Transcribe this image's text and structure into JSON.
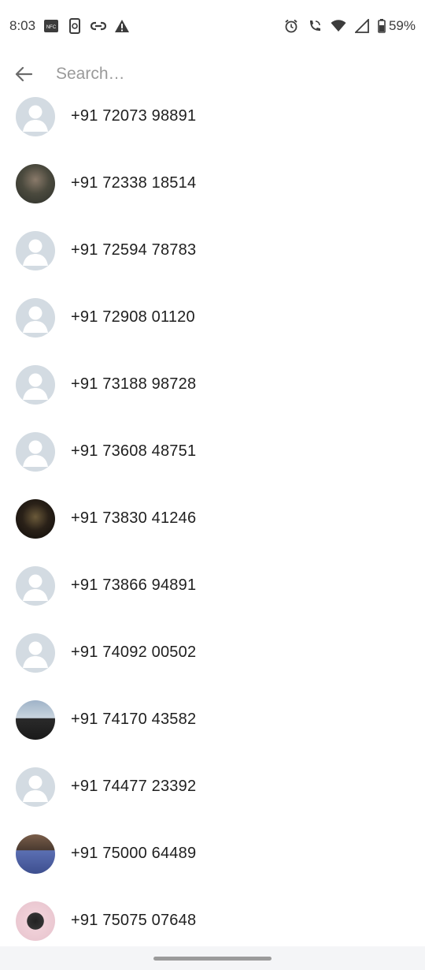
{
  "status_bar": {
    "time": "8:03",
    "battery": "59%",
    "left_icons": [
      "nfc-icon",
      "phone-lock-icon",
      "link-icon",
      "warning-icon"
    ],
    "right_icons": [
      "alarm-icon",
      "wifi-call-icon",
      "wifi-icon",
      "signal-icon",
      "battery-icon"
    ]
  },
  "search": {
    "placeholder": "Search…",
    "value": ""
  },
  "contacts": [
    {
      "phone": "+91 72073 98891",
      "avatar": "default"
    },
    {
      "phone": "+91 72338 18514",
      "avatar": "photo"
    },
    {
      "phone": "+91 72594 78783",
      "avatar": "default"
    },
    {
      "phone": "+91 72908 01120",
      "avatar": "default"
    },
    {
      "phone": "+91 73188 98728",
      "avatar": "default"
    },
    {
      "phone": "+91 73608 48751",
      "avatar": "default"
    },
    {
      "phone": "+91 73830 41246",
      "avatar": "photo"
    },
    {
      "phone": "+91 73866 94891",
      "avatar": "default"
    },
    {
      "phone": "+91 74092 00502",
      "avatar": "default"
    },
    {
      "phone": "+91 74170 43582",
      "avatar": "photo"
    },
    {
      "phone": "+91 74477 23392",
      "avatar": "default"
    },
    {
      "phone": "+91 75000 64489",
      "avatar": "photo"
    },
    {
      "phone": "+91 75075 07648",
      "avatar": "photo"
    }
  ],
  "colors": {
    "default_avatar_bg": "#d3dbe2",
    "default_avatar_fg": "#ffffff"
  }
}
